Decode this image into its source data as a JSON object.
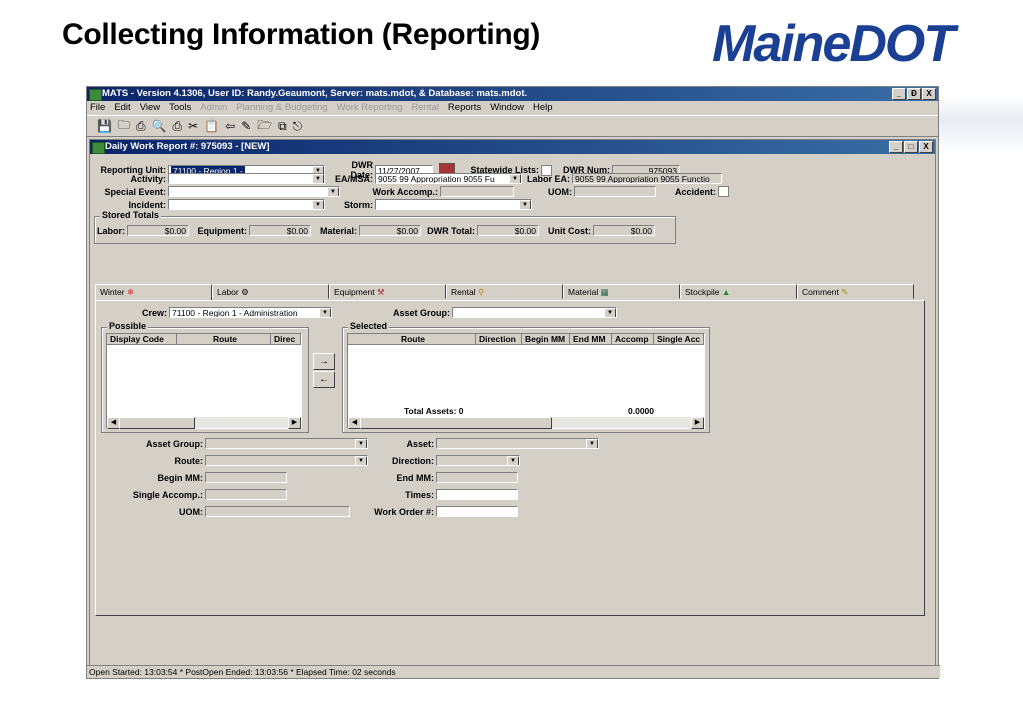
{
  "slide": {
    "title": "Collecting Information (Reporting)",
    "logo": "MaineDOT"
  },
  "app": {
    "title": "MATS - Version 4.1306, User ID: Randy.Geaumont, Server: mats.mdot, & Database: mats.mdot.",
    "window_buttons": [
      "_",
      "Ɖ",
      "X"
    ],
    "menu": [
      "File",
      "Edit",
      "View",
      "Tools",
      "Admin",
      "Planning & Budgeting",
      "Work Reporting",
      "Rental",
      "Reports",
      "Window",
      "Help"
    ],
    "toolbar_icons": [
      "save-icon",
      "open-icon",
      "print-icon",
      "print-preview-icon",
      "print-alt-icon",
      "cut-icon",
      "paste-icon",
      "back-icon",
      "pen-icon",
      "folder-icon",
      "copy-icon",
      "exit-icon"
    ]
  },
  "form": {
    "title": "Daily Work Report #: 975093 - [NEW]",
    "labels": {
      "reporting_unit": "Reporting Unit:",
      "dwr_date": "DWR Date:",
      "statewide_lists": "Statewide Lists:",
      "dwr_num": "DWR Num:",
      "activity": "Activity:",
      "ea_msa": "EA/MSA:",
      "labor_ea": "Labor EA:",
      "special_event": "Special Event:",
      "work_accomp": "Work Accomp.:",
      "uom": "UOM:",
      "accident": "Accident:",
      "incident": "Incident:",
      "storm": "Storm:"
    },
    "values": {
      "reporting_unit": "71100 - Region 1 -",
      "dwr_date": "11/27/2007",
      "dwr_num": "975093",
      "ea_msa": "9055 99 Appropriation 9055 Fu",
      "labor_ea": "9055 99 Appropriation 9055 Functio"
    },
    "stored_totals": {
      "title": "Stored Totals",
      "labor_label": "Labor:",
      "labor": "$0.00",
      "equipment_label": "Equipment:",
      "equipment": "$0.00",
      "material_label": "Material:",
      "material": "$0.00",
      "dwr_total_label": "DWR Total:",
      "dwr_total": "$0.00",
      "unit_cost_label": "Unit Cost:",
      "unit_cost": "$0.00"
    }
  },
  "tabs": [
    {
      "label": "Winter",
      "icon": "snow-icon"
    },
    {
      "label": "Labor",
      "icon": "worker-icon"
    },
    {
      "label": "Equipment",
      "icon": "truck-icon"
    },
    {
      "label": "Rental",
      "icon": "key-icon"
    },
    {
      "label": "Material",
      "icon": "material-icon"
    },
    {
      "label": "Stockpile",
      "icon": "stockpile-icon"
    },
    {
      "label": "Comment",
      "icon": "pencil-icon"
    }
  ],
  "winter": {
    "crew_label": "Crew:",
    "crew": "71100 - Region 1 - Administration",
    "asset_group_label": "Asset Group:",
    "possible": {
      "title": "Possible",
      "columns": [
        "Display Code",
        "Route",
        "Direc"
      ]
    },
    "selected": {
      "title": "Selected",
      "columns": [
        "Route",
        "Direction",
        "Begin MM",
        "End MM",
        "Accomp",
        "Single Acc"
      ],
      "total_label": "Total Assets: 0",
      "total_value": "0.0000"
    },
    "move_right": "→",
    "move_left": "←",
    "detail_labels": {
      "asset_group": "Asset Group:",
      "asset": "Asset:",
      "route": "Route:",
      "direction": "Direction:",
      "begin_mm": "Begin MM:",
      "end_mm": "End MM:",
      "single_accomp": "Single Accomp.:",
      "times": "Times:",
      "uom": "UOM:",
      "work_order": "Work Order #:"
    }
  },
  "status": "Open Started: 13:03:54 * PostOpen Ended: 13:03:56 * Elapsed Time: 02 seconds"
}
